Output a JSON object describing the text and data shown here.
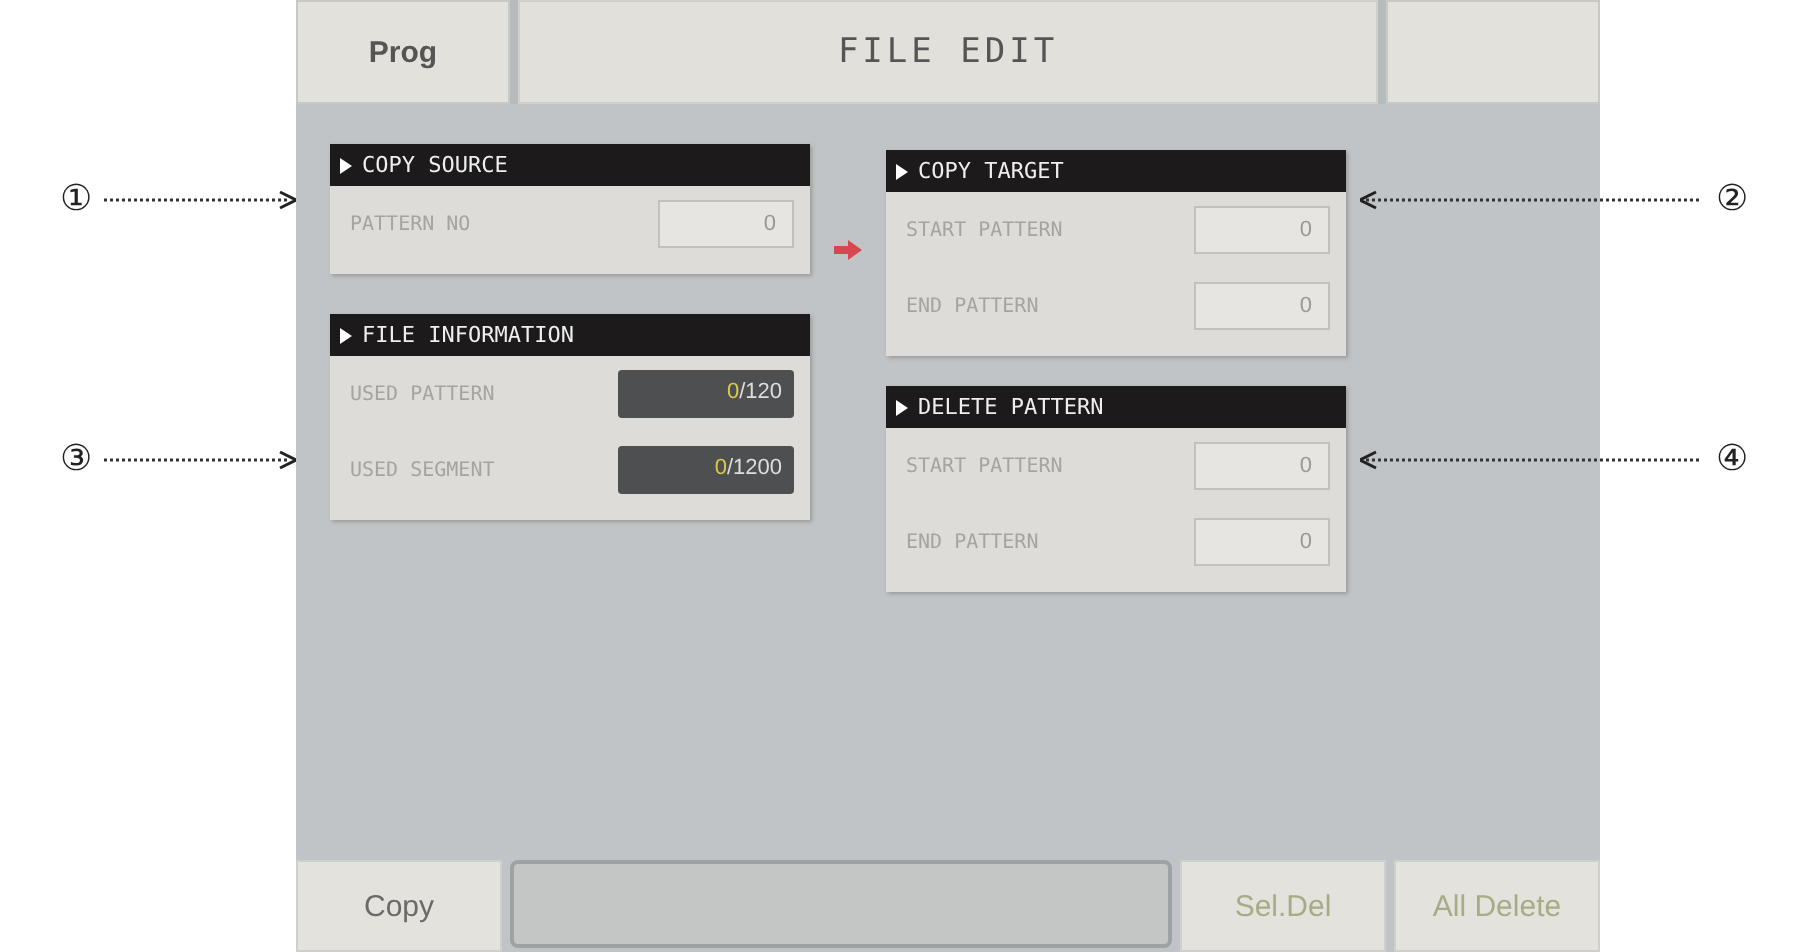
{
  "header": {
    "left_button": "Prog",
    "title": "FILE EDIT"
  },
  "panels": [
    {
      "title": "COPY SOURCE",
      "fields": [
        {
          "label": "PATTERN NO",
          "kind": "input",
          "value": "0"
        }
      ]
    },
    {
      "title": "COPY TARGET",
      "fields": [
        {
          "label": "START PATTERN",
          "kind": "input",
          "value": "0"
        },
        {
          "label": "END PATTERN",
          "kind": "input",
          "value": "0"
        }
      ]
    },
    {
      "title": "FILE INFORMATION",
      "fields": [
        {
          "label": "USED PATTERN",
          "kind": "usage",
          "used": "0",
          "total": "/120"
        },
        {
          "label": "USED SEGMENT",
          "kind": "usage",
          "used": "0",
          "total": "/1200"
        }
      ]
    },
    {
      "title": "DELETE PATTERN",
      "fields": [
        {
          "label": "START PATTERN",
          "kind": "input",
          "value": "0"
        },
        {
          "label": "END PATTERN",
          "kind": "input",
          "value": "0"
        }
      ]
    }
  ],
  "footer": {
    "buttons": [
      {
        "label": "Copy",
        "disabled": false
      },
      {
        "label": "Sel.Del",
        "disabled": true
      },
      {
        "label": "All Delete",
        "disabled": true
      }
    ]
  },
  "callouts": [
    "①",
    "②",
    "③",
    "④"
  ]
}
